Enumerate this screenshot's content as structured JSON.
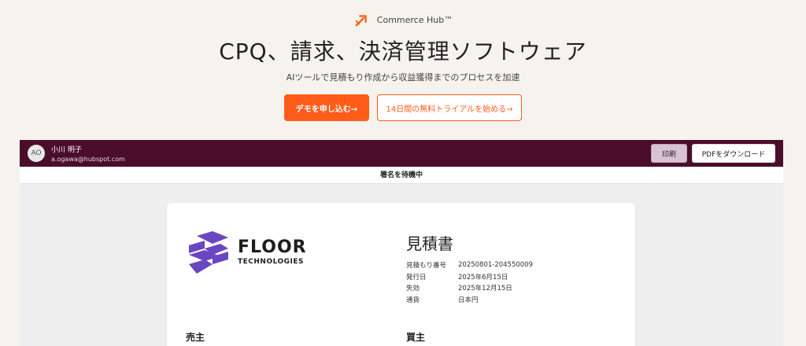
{
  "hero": {
    "brand": "Commerce Hub™",
    "title": "CPQ、請求、決済管理ソフトウェア",
    "subtitle": "AIツールで見積もり作成から収益獲得までのプロセスを加速",
    "primary_cta": "デモを申し込む→",
    "secondary_cta": "14日間の無料トライアルを始める→"
  },
  "viewer": {
    "avatar_initials": "AO",
    "user_name": "小川 明子",
    "user_email": "a.ogawa@hubspot.com",
    "print_label": "印刷",
    "download_label": "PDFをダウンロード",
    "status": "署名を待機中"
  },
  "document": {
    "logo_name": "FLOOR",
    "logo_sub": "TECHNOLOGIES",
    "title": "見積書",
    "meta": [
      {
        "label": "見積もり番号",
        "value": "20250801-204550009"
      },
      {
        "label": "発行日",
        "value": "2025年6月15日"
      },
      {
        "label": "失効",
        "value": "2025年12月15日"
      },
      {
        "label": "通貨",
        "value": "日本円"
      }
    ],
    "seller_heading": "売主",
    "buyer_heading": "買主"
  },
  "colors": {
    "accent": "#ff5c1a",
    "bar": "#4b0d2c",
    "logo_purple": "#6b46c1"
  }
}
